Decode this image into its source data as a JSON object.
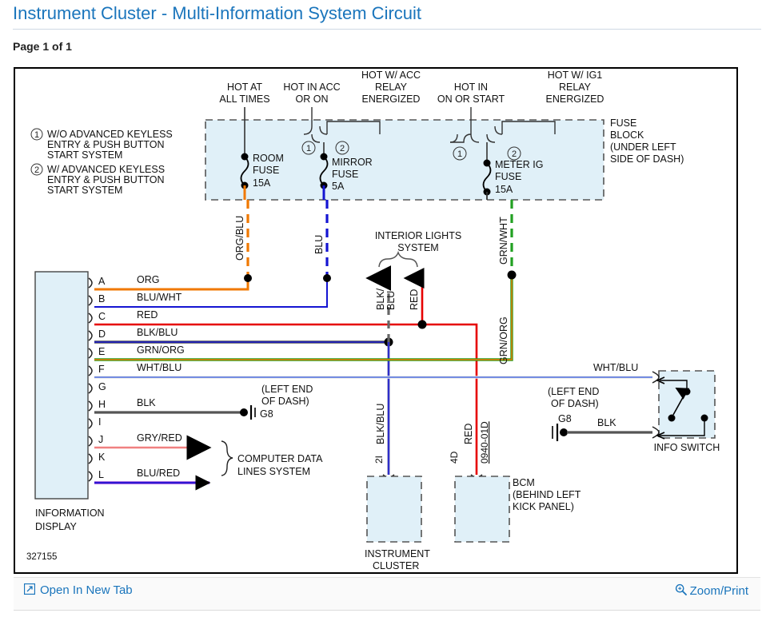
{
  "header": {
    "title": "Instrument Cluster - Multi-Information System Circuit",
    "page_count": "Page 1 of 1",
    "title_color": "#1a75bc"
  },
  "footer": {
    "open_new_tab": "Open In New Tab",
    "open_new_tab_icon": "external-link-icon",
    "zoom_print": "Zoom/Print",
    "zoom_print_icon": "magnifier-icon",
    "link_color": "#1a75bc"
  },
  "diagram": {
    "number": "327155",
    "legend": [
      {
        "marker": "1",
        "lines": [
          "W/O ADVANCED KEYLESS",
          "ENTRY & PUSH BUTTON",
          "START SYSTEM"
        ]
      },
      {
        "marker": "2",
        "lines": [
          "W/ ADVANCED KEYLESS",
          "ENTRY & PUSH BUTTON",
          "START SYSTEM"
        ]
      }
    ],
    "power_sources": [
      {
        "id": "hot-at-all-times",
        "lines": [
          "HOT AT",
          "ALL TIMES"
        ]
      },
      {
        "id": "hot-in-acc-or-on",
        "lines": [
          "HOT IN ACC",
          "OR ON"
        ]
      },
      {
        "id": "hot-w-acc-relay-energized",
        "lines": [
          "HOT W/ ACC",
          "RELAY",
          "ENERGIZED"
        ]
      },
      {
        "id": "hot-in-on-or-start",
        "lines": [
          "HOT IN",
          "ON OR START"
        ]
      },
      {
        "id": "hot-w-ig1-relay-energized",
        "lines": [
          "HOT W/ IG1",
          "RELAY",
          "ENERGIZED"
        ]
      }
    ],
    "fuse_block_label": [
      "FUSE",
      "BLOCK",
      "(UNDER LEFT",
      "SIDE OF DASH)"
    ],
    "fuses": [
      {
        "name": "ROOM",
        "word2": "FUSE",
        "rating": "15A",
        "out_wire": "ORG/BLU",
        "color": "#f07800"
      },
      {
        "name": "MIRROR",
        "word2": "FUSE",
        "rating": "5A",
        "out_wire": "BLU",
        "color": "#1414d2"
      },
      {
        "name": "METER IG",
        "word2": "FUSE",
        "rating": "15A",
        "out_wire": "GRN/WHT",
        "color": "#21a021"
      }
    ],
    "fuse_option_markers": [
      "1",
      "2",
      "1",
      "2"
    ],
    "connector": {
      "component": [
        "INFORMATION",
        "DISPLAY"
      ],
      "pins": [
        {
          "pin": "A",
          "wire": "ORG",
          "c1": "#f07800",
          "c2": "#f07800"
        },
        {
          "pin": "B",
          "wire": "BLU/WHT",
          "c1": "#1414d2",
          "c2": "#ffffff"
        },
        {
          "pin": "C",
          "wire": "RED",
          "c1": "#e60000",
          "c2": "#e60000"
        },
        {
          "pin": "D",
          "wire": "BLK/BLU",
          "c1": "#555555",
          "c2": "#1414d2"
        },
        {
          "pin": "E",
          "wire": "GRN/ORG",
          "c1": "#21a021",
          "c2": "#f07800"
        },
        {
          "pin": "F",
          "wire": "WHT/BLU",
          "c1": "#e8e8e8",
          "c2": "#4d6ee0"
        },
        {
          "pin": "G",
          "wire": "",
          "c1": "",
          "c2": ""
        },
        {
          "pin": "H",
          "wire": "BLK",
          "c1": "#555555",
          "c2": "#555555"
        },
        {
          "pin": "I",
          "wire": "",
          "c1": "",
          "c2": ""
        },
        {
          "pin": "J",
          "wire": "GRY/RED",
          "c1": "#f08080",
          "c2": "#f08080"
        },
        {
          "pin": "K",
          "wire": "",
          "c1": "",
          "c2": ""
        },
        {
          "pin": "L",
          "wire": "BLU/RED",
          "c1": "#1414d2",
          "c2": "#7a1fd2"
        }
      ]
    },
    "vertical_wire_labels": [
      {
        "id": "org-blu",
        "text": "ORG/BLU"
      },
      {
        "id": "blu",
        "text": "BLU"
      },
      {
        "id": "blk-blu-top",
        "text": "BLK/\nBLU"
      },
      {
        "id": "red-top",
        "text": "RED"
      },
      {
        "id": "grn-wht",
        "text": "GRN/WHT"
      },
      {
        "id": "grn-org",
        "text": "GRN/ORG"
      },
      {
        "id": "blk-blu-bottom",
        "text": "BLK/BLU"
      },
      {
        "id": "red-bcm",
        "text": "RED"
      }
    ],
    "systems": {
      "interior_lights": [
        "INTERIOR LIGHTS",
        "SYSTEM"
      ],
      "computer_data": [
        "COMPUTER DATA",
        "LINES SYSTEM"
      ]
    },
    "grounds": [
      {
        "id": "g8-left",
        "name": "G8",
        "note": [
          "(LEFT END",
          "OF DASH)"
        ]
      },
      {
        "id": "g8-right",
        "name": "G8",
        "note": [
          "(LEFT END",
          "OF DASH)"
        ]
      }
    ],
    "modules": [
      {
        "id": "instrument-cluster",
        "label": [
          "INSTRUMENT",
          "CLUSTER"
        ],
        "pin": "2I"
      },
      {
        "id": "bcm",
        "label": [
          "BCM",
          "(BEHIND LEFT",
          "KICK PANEL)"
        ],
        "pin": "4D",
        "code": "0940-01D"
      }
    ],
    "info_switch": {
      "label": "INFO SWITCH",
      "in_wire": "WHT/BLU",
      "gnd_wire": "BLK"
    }
  }
}
